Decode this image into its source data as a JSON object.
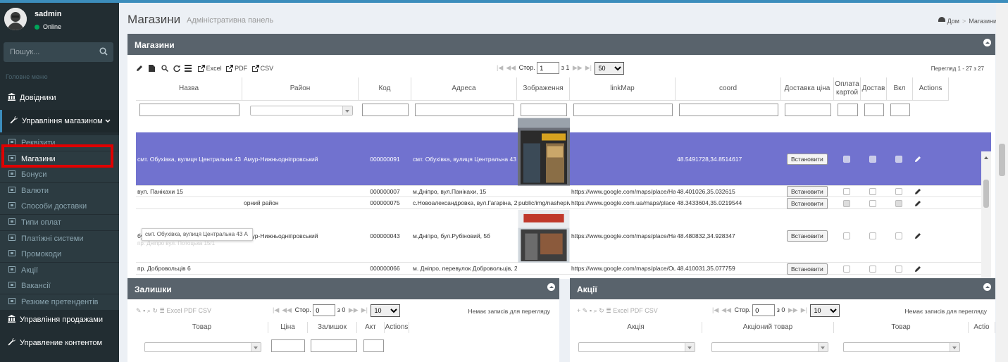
{
  "user": {
    "name": "sadmin",
    "status": "Online"
  },
  "sidebar": {
    "search_placeholder": "Пошук...",
    "header": "Головне меню",
    "items": [
      {
        "label": "Довідники"
      },
      {
        "label": "Управління магазином"
      }
    ],
    "sub_items": [
      {
        "label": "Реквізити"
      },
      {
        "label": "Магазини"
      },
      {
        "label": "Бонуси"
      },
      {
        "label": "Валюти"
      },
      {
        "label": "Способи доставки"
      },
      {
        "label": "Типи оплат"
      },
      {
        "label": "Платіжні системи"
      },
      {
        "label": "Промокоди"
      },
      {
        "label": "Акції"
      },
      {
        "label": "Вакансії"
      },
      {
        "label": "Резюме претендентів"
      }
    ],
    "bottom_items": [
      {
        "label": "Управління продажами"
      },
      {
        "label": "Управление контентом"
      }
    ]
  },
  "page": {
    "title": "Магазини",
    "subtitle": "Адміністративна панель"
  },
  "breadcrumb": {
    "home": "Дом",
    "current": "Магазини"
  },
  "main_box": {
    "title": "Магазини",
    "toolbar": {
      "excel": "Excel",
      "pdf": "PDF",
      "csv": "CSV"
    },
    "pager": {
      "page_label": "Стор.",
      "page": "1",
      "of": "з 1",
      "rows": "50"
    },
    "view": "Перегляд 1 - 27 з 27",
    "columns": [
      "Назва",
      "Район",
      "Код",
      "Адреса",
      "Зображення",
      "linkMap",
      "coord",
      "Доставка ціна",
      "Оплата картой",
      "Достав",
      "Вкл",
      "Actions"
    ],
    "set_label": "Встановити",
    "rows": [
      {
        "name": "смт. Обухівка, вулиця Центральна 43 А",
        "district": "Амур-Нижньодніпровський",
        "code": "000000091",
        "address": "смт. Обухівка, вулиця Центральна 43 А",
        "image": "",
        "link": "",
        "coord": "48.5491728,34.8514617"
      },
      {
        "name": "вул. Панікахи 15",
        "district": "",
        "code": "000000007",
        "address": "м.Дніпро, вул.Панікахи, 15",
        "image": "",
        "link": "https://www.google.com/maps/place/На",
        "coord": "48.401026,35.032615"
      },
      {
        "name": "",
        "district": "орний район",
        "code": "000000075",
        "address": "с.Новоалександровка, вул.Гагаріна, 2а",
        "image": "public/img/nashepiv",
        "link": "https://www.google.com.ua/maps/place",
        "coord": "48.3433604,35.0219544"
      },
      {
        "name": "бул. Рубіновий 5 Б",
        "district": "Амур-Нижньодніпровський",
        "code": "000000043",
        "address": "м.Дніпро, бул.Рубіновий, 5б",
        "image": "",
        "link": "https://www.google.com/maps/place/На",
        "coord": "48.480832,34.928347"
      },
      {
        "name": "пр. Добровольців 6",
        "district": "",
        "code": "000000066",
        "address": "м. Дніпро, перевулок Добровольців, 2",
        "image": "",
        "link": "https://www.google.com/maps/place/Ou",
        "coord": "48.410031,35.077759"
      }
    ],
    "tooltip": "смт. Обухівка, вулиця Центральна 43 А",
    "ghost_text": "пр. Дніпро вул. Потоцька 15/1"
  },
  "stock_box": {
    "title": "Залишки",
    "columns": [
      "Товар",
      "Ціна",
      "Залишок",
      "Акт",
      "Actions"
    ],
    "pager": {
      "page_label": "Стор.",
      "page": "0",
      "of": "з 0",
      "rows": "10"
    },
    "empty": "Немає записів для перегляду",
    "toolbar": {
      "excel": "Excel",
      "pdf": "PDF",
      "csv": "CSV"
    }
  },
  "promo_box": {
    "title": "Акції",
    "columns": [
      "Акція",
      "Акціоний товар",
      "Товар",
      "Actio"
    ],
    "pager": {
      "page_label": "Стор.",
      "page": "0",
      "of": "з 0",
      "rows": "10"
    },
    "empty": "Немає записів для перегляду",
    "toolbar": {
      "excel": "Excel",
      "pdf": "PDF",
      "csv": "CSV"
    }
  },
  "colors": {
    "selected_row": "#7172cf",
    "header": "#59636c",
    "sidebar": "#222d32",
    "accent": "#3c8dbc"
  }
}
